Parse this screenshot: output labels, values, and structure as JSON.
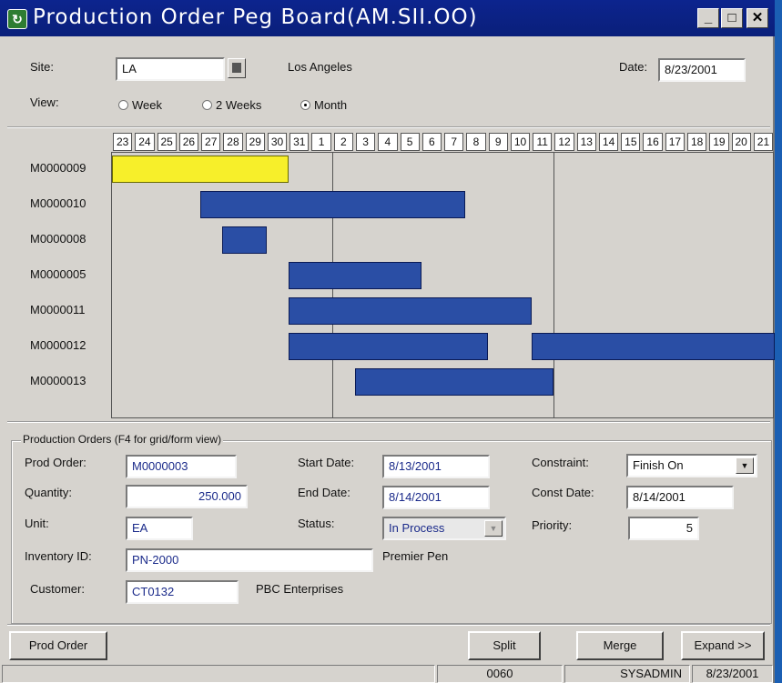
{
  "window": {
    "title": "Production Order Peg Board(AM.SII.OO)",
    "min": "_",
    "max": "□",
    "close": "✕"
  },
  "header": {
    "site_label": "Site:",
    "site_value": "LA",
    "site_name": "Los Angeles",
    "date_label": "Date:",
    "date_value": "8/23/2001",
    "view_label": "View:",
    "view_options": [
      {
        "label": "Week",
        "selected": false
      },
      {
        "label": "2 Weeks",
        "selected": false
      },
      {
        "label": "Month",
        "selected": true
      }
    ]
  },
  "peg_board": {
    "days": [
      "23",
      "24",
      "25",
      "26",
      "27",
      "28",
      "29",
      "30",
      "31",
      "1",
      "2",
      "3",
      "4",
      "5",
      "6",
      "7",
      "8",
      "9",
      "10",
      "11",
      "12",
      "13",
      "14",
      "15",
      "16",
      "17",
      "18",
      "19",
      "20",
      "21"
    ],
    "orders": [
      {
        "label": "M0000009",
        "bars": [
          {
            "start_day": "23",
            "end_day": "30",
            "color": "#f7ef2a"
          }
        ]
      },
      {
        "label": "M0000010",
        "bars": [
          {
            "start_day": "27",
            "end_day": "7",
            "color": "#2a4ea5"
          }
        ]
      },
      {
        "label": "M0000008",
        "bars": [
          {
            "start_day": "28",
            "end_day": "29",
            "color": "#2a4ea5"
          }
        ]
      },
      {
        "label": "M0000005",
        "bars": [
          {
            "start_day": "31",
            "end_day": "5",
            "color": "#2a4ea5"
          }
        ]
      },
      {
        "label": "M0000011",
        "bars": [
          {
            "start_day": "31",
            "end_day": "10",
            "color": "#2a4ea5"
          }
        ]
      },
      {
        "label": "M0000012",
        "bars": [
          {
            "start_day": "31",
            "end_day": "8",
            "color": "#2a4ea5"
          },
          {
            "start_day": "11",
            "end_day": "21",
            "color": "#2a4ea5"
          }
        ]
      },
      {
        "label": "M0000013",
        "bars": [
          {
            "start_day": "3",
            "end_day": "11",
            "color": "#2a4ea5"
          }
        ]
      }
    ]
  },
  "details": {
    "group_title": "Production Orders (F4 for grid/form view)",
    "prod_order_label": "Prod Order:",
    "prod_order_value": "M0000003",
    "quantity_label": "Quantity:",
    "quantity_value": "250.000",
    "unit_label": "Unit:",
    "unit_value": "EA",
    "inventory_label": "Inventory ID:",
    "inventory_value": "PN-2000",
    "inventory_desc": "Premier Pen",
    "customer_label": "Customer:",
    "customer_value": "CT0132",
    "customer_name": "PBC Enterprises",
    "start_label": "Start Date:",
    "start_value": "8/13/2001",
    "end_label": "End Date:",
    "end_value": "8/14/2001",
    "status_label": "Status:",
    "status_value": "In Process",
    "constraint_label": "Constraint:",
    "constraint_value": "Finish On",
    "const_date_label": "Const Date:",
    "const_date_value": "8/14/2001",
    "priority_label": "Priority:",
    "priority_value": "5"
  },
  "buttons": {
    "prod_order": "Prod Order",
    "split": "Split",
    "merge": "Merge",
    "expand": "Expand >>"
  },
  "statusbar": {
    "code": "0060",
    "user": "SYSADMIN",
    "date": "8/23/2001"
  }
}
